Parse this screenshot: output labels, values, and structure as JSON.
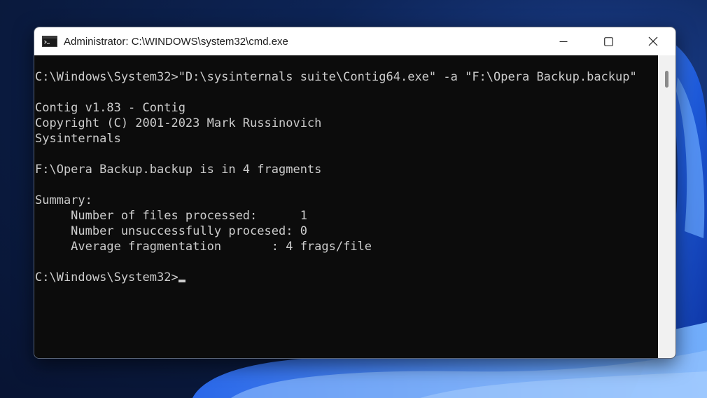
{
  "window": {
    "title": "Administrator: C:\\WINDOWS\\system32\\cmd.exe"
  },
  "controls": {
    "minimize_icon": "minimize-icon",
    "maximize_icon": "maximize-icon",
    "close_icon": "close-icon"
  },
  "terminal": {
    "lines": [
      "C:\\Windows\\System32>\"D:\\sysinternals suite\\Contig64.exe\" -a \"F:\\Opera Backup.backup\"",
      "",
      "Contig v1.83 - Contig",
      "Copyright (C) 2001-2023 Mark Russinovich",
      "Sysinternals",
      "",
      "F:\\Opera Backup.backup is in 4 fragments",
      "",
      "Summary:",
      "     Number of files processed:      1",
      "     Number unsuccessfully procesed: 0",
      "     Average fragmentation       : 4 frags/file",
      "",
      "C:\\Windows\\System32>"
    ]
  },
  "colors": {
    "terminal_bg": "#0c0c0c",
    "terminal_fg": "#cccccc",
    "titlebar_bg": "#ffffff",
    "desktop_bg": "#0a1a3e"
  }
}
